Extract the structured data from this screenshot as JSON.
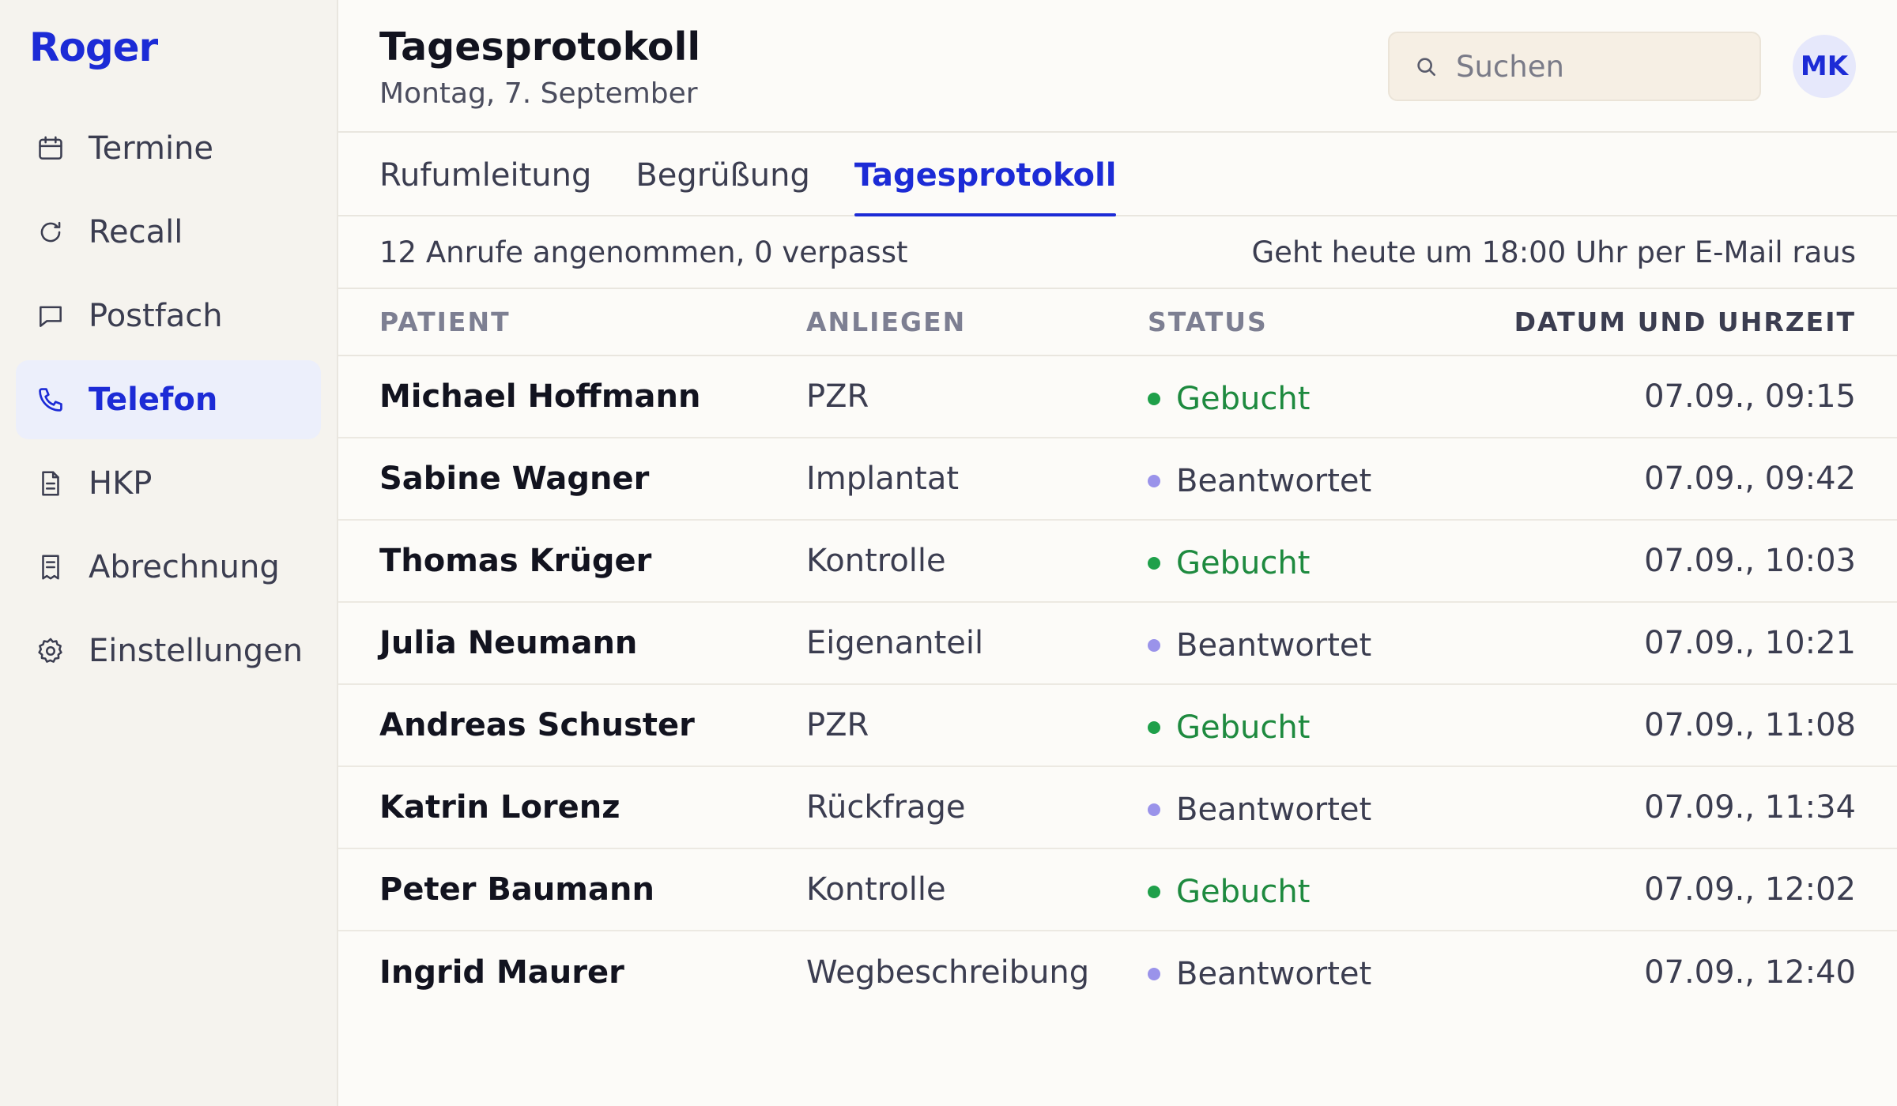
{
  "brand": {
    "logo": "Roger",
    "accent": "#1c2bd6"
  },
  "sidebar": {
    "items": [
      {
        "label": "Termine",
        "icon": "calendar-icon",
        "active": false
      },
      {
        "label": "Recall",
        "icon": "refresh-icon",
        "active": false
      },
      {
        "label": "Postfach",
        "icon": "chat-bubble-icon",
        "active": false
      },
      {
        "label": "Telefon",
        "icon": "phone-icon",
        "active": true
      },
      {
        "label": "HKP",
        "icon": "document-icon",
        "active": false
      },
      {
        "label": "Abrechnung",
        "icon": "receipt-icon",
        "active": false
      },
      {
        "label": "Einstellungen",
        "icon": "gear-icon",
        "active": false
      }
    ]
  },
  "header": {
    "title": "Tagesprotokoll",
    "subtitle": "Montag, 7. September",
    "search_placeholder": "Suchen",
    "avatar_initials": "MK"
  },
  "tabs": [
    {
      "label": "Rufumleitung",
      "active": false
    },
    {
      "label": "Begrüßung",
      "active": false
    },
    {
      "label": "Tagesprotokoll",
      "active": true
    }
  ],
  "summary": {
    "left": "12 Anrufe angenommen, 0 verpasst",
    "right": "Geht heute um 18:00 Uhr per E-Mail raus"
  },
  "table": {
    "headers": {
      "patient": "PATIENT",
      "anliegen": "ANLIEGEN",
      "status": "STATUS",
      "date": "DATUM UND UHRZEIT"
    },
    "rows": [
      {
        "patient": "Michael Hoffmann",
        "anliegen": "PZR",
        "status": "Gebucht",
        "status_type": "booked",
        "date": "07.09., 09:15"
      },
      {
        "patient": "Sabine Wagner",
        "anliegen": "Implantat",
        "status": "Beantwortet",
        "status_type": "answered",
        "date": "07.09., 09:42"
      },
      {
        "patient": "Thomas Krüger",
        "anliegen": "Kontrolle",
        "status": "Gebucht",
        "status_type": "booked",
        "date": "07.09., 10:03"
      },
      {
        "patient": "Julia Neumann",
        "anliegen": "Eigenanteil",
        "status": "Beantwortet",
        "status_type": "answered",
        "date": "07.09., 10:21"
      },
      {
        "patient": "Andreas Schuster",
        "anliegen": "PZR",
        "status": "Gebucht",
        "status_type": "booked",
        "date": "07.09., 11:08"
      },
      {
        "patient": "Katrin Lorenz",
        "anliegen": "Rückfrage",
        "status": "Beantwortet",
        "status_type": "answered",
        "date": "07.09., 11:34"
      },
      {
        "patient": "Peter Baumann",
        "anliegen": "Kontrolle",
        "status": "Gebucht",
        "status_type": "booked",
        "date": "07.09., 12:02"
      },
      {
        "patient": "Ingrid Maurer",
        "anliegen": "Wegbeschreibung",
        "status": "Beantwortet",
        "status_type": "answered",
        "date": "07.09., 12:40"
      }
    ]
  }
}
